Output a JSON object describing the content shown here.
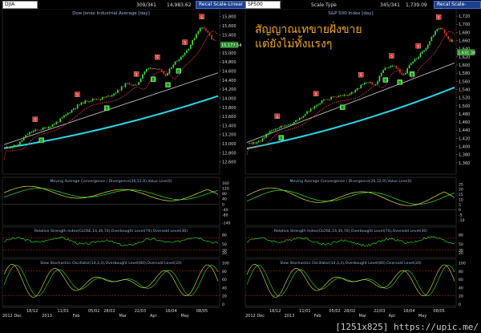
{
  "watermark": "[1251x825] https://upic.me/",
  "annotation": {
    "line1": "สัญญาณเทขายฝั่งขาย",
    "line2": "แต่ยังไม่ทั้งแรงๆ"
  },
  "colors": {
    "background": "#000000",
    "up_candle": "#2eea2e",
    "down_candle": "#e32b2b",
    "ma_fast": "#ff4040",
    "ma_mid": "#d0d0d0",
    "ma_slow": "#29d7e6",
    "macd_line": "#e8e83a",
    "macd_signal": "#2ee82e",
    "threshold": "#e32b2b"
  },
  "panels": [
    {
      "id": "left",
      "symbol": "DJIA",
      "header_counts": "309/341",
      "header_value": "14,983.62",
      "recal_label": "Recal Scale-Linear",
      "scale_type": "",
      "date_start": "2012 Dec",
      "date_ticks": [
        "18/12",
        "2013",
        "11/01",
        "Feb",
        "05/02",
        "28/02",
        "Mar",
        "22/03",
        "Apr",
        "16/04",
        "May",
        "08/05"
      ],
      "chart_data": [
        {
          "type": "candlestick",
          "title": "Dow Jones Industrial Average [day]",
          "ylim": [
            12400,
            15900
          ],
          "yticks": [
            "15,800",
            "15,600",
            "15,400",
            "15,200",
            "15,000",
            "14,800",
            "14,600",
            "14,400",
            "14,200",
            "14,000",
            "13,800",
            "13,600",
            "13,400",
            "13,200",
            "13,000",
            "12,800",
            "12,600"
          ],
          "last_price_label": "15,177.54",
          "series": [
            {
              "name": "price",
              "start": 12950,
              "end": 15177,
              "peak": 15550,
              "low": 12850
            },
            {
              "name": "ma_fast",
              "start": 12650,
              "end": 15350
            },
            {
              "name": "ma_mid",
              "start": 12980,
              "end": 14560
            },
            {
              "name": "ma_slow",
              "start": 12900,
              "end": 14050
            }
          ],
          "signals_S": [
            0.14,
            0.34,
            0.62,
            0.72,
            0.85,
            0.93
          ],
          "signals_B": [
            0.17,
            0.48,
            0.7,
            0.77,
            0.82
          ]
        },
        {
          "type": "line",
          "title": "Moving Average Convergence / Divergence(26,12,9),Value Line(0)",
          "ylim": [
            -150,
            190
          ],
          "yticks": [
            "160",
            "120",
            "80",
            "40",
            "0",
            "-40",
            "-80",
            "-140"
          ]
        },
        {
          "type": "line",
          "title": "Relative Strength Index(CLOSE,14,30,70),Overbought Level(70),Oversold Level(30)",
          "ylim": [
            10,
            100
          ],
          "yticks": [
            "80",
            "50",
            "30",
            "20"
          ]
        },
        {
          "type": "line",
          "title": "Slow Stochastics Oscillator(14,3,3),Overbought Level(80),Oversold Level(20)",
          "ylim": [
            0,
            105
          ],
          "yticks": [
            "100",
            "80",
            "60",
            "40",
            "20",
            "0"
          ]
        }
      ]
    },
    {
      "id": "right",
      "symbol": "SP500",
      "header_counts": "345/341",
      "header_value": "1,739.09",
      "recal_label": "Recal Scale-Linear",
      "scale_type": "Scale Type",
      "date_start": "2012 Dec",
      "date_ticks": [
        "18/12",
        "2013",
        "11/01",
        "Feb",
        "05/02",
        "28/02",
        "Mar",
        "22/03",
        "Apr",
        "16/04",
        "May",
        "08/05"
      ],
      "chart_data": [
        {
          "type": "candlestick",
          "title": "S&P 500 Index [day]",
          "ylim": [
            1340,
            1730
          ],
          "yticks": [
            "1,720",
            "1,700",
            "1,680",
            "1,660",
            "1,640",
            "1,620",
            "1,600",
            "1,580",
            "1,560",
            "1,540",
            "1,520",
            "1,500",
            "1,480",
            "1,460",
            "1,440",
            "1,420",
            "1,400",
            "1,380",
            "1,360"
          ],
          "last_price_label": "1,631.38",
          "series": [
            {
              "name": "price",
              "start": 1410,
              "end": 1631,
              "peak": 1690,
              "low": 1395
            },
            {
              "name": "ma_fast",
              "start": 1380,
              "end": 1660
            },
            {
              "name": "ma_mid",
              "start": 1410,
              "end": 1605
            },
            {
              "name": "ma_slow",
              "start": 1395,
              "end": 1545
            }
          ],
          "signals_S": [
            0.14,
            0.33,
            0.55,
            0.7,
            0.83,
            0.93
          ],
          "signals_B": [
            0.16,
            0.46,
            0.67,
            0.74,
            0.8
          ]
        },
        {
          "type": "line",
          "title": "Moving Average Convergence / Divergence(26,12,9),Value Line(0)",
          "ylim": [
            -14,
            30
          ],
          "yticks": [
            "25",
            "20",
            "15",
            "10",
            "5",
            "0",
            "-5",
            "-10"
          ]
        },
        {
          "type": "line",
          "title": "Relative Strength Index(CLOSE,14,30,70),Overbought Level(70),Oversold Level(30)",
          "ylim": [
            10,
            100
          ],
          "yticks": [
            "80",
            "50",
            "30",
            "20"
          ]
        },
        {
          "type": "line",
          "title": "Slow Stochastics Oscillator(14,3,3),Overbought Level(80),Oversold Level(20)",
          "ylim": [
            0,
            105
          ],
          "yticks": [
            "100",
            "80",
            "60",
            "40",
            "20",
            "0"
          ]
        }
      ]
    }
  ]
}
